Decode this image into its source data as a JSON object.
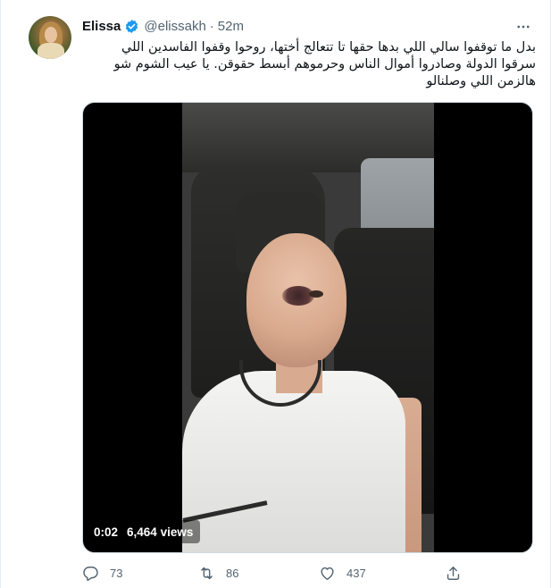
{
  "tweet": {
    "author_name": "Elissa",
    "handle": "@elissakh",
    "separator": "·",
    "timestamp": "52m",
    "text_lines": [
      "بدل ما توقفوا سالي اللي بدها حقها تا تتعالج أختها، روحوا وقفوا الفاسدين اللي",
      "سرقوا الدولة وصادروا أموال الناس وحرموهم أبسط حقوقن. يا عيب الشوم شو",
      "هالزمن اللي وصلنالو"
    ],
    "verified": true
  },
  "video": {
    "elapsed": "0:02",
    "views": "6,464 views"
  },
  "actions": {
    "reply_count": "73",
    "retweet_count": "86",
    "like_count": "437"
  },
  "icons": {
    "verified": "verified-badge-icon",
    "more": "more-horizontal-icon",
    "reply": "reply-icon",
    "retweet": "retweet-icon",
    "like": "heart-icon",
    "share": "share-icon"
  },
  "colors": {
    "accent": "#1d9bf0",
    "secondary_text": "#536471",
    "primary_text": "#0f1419"
  }
}
